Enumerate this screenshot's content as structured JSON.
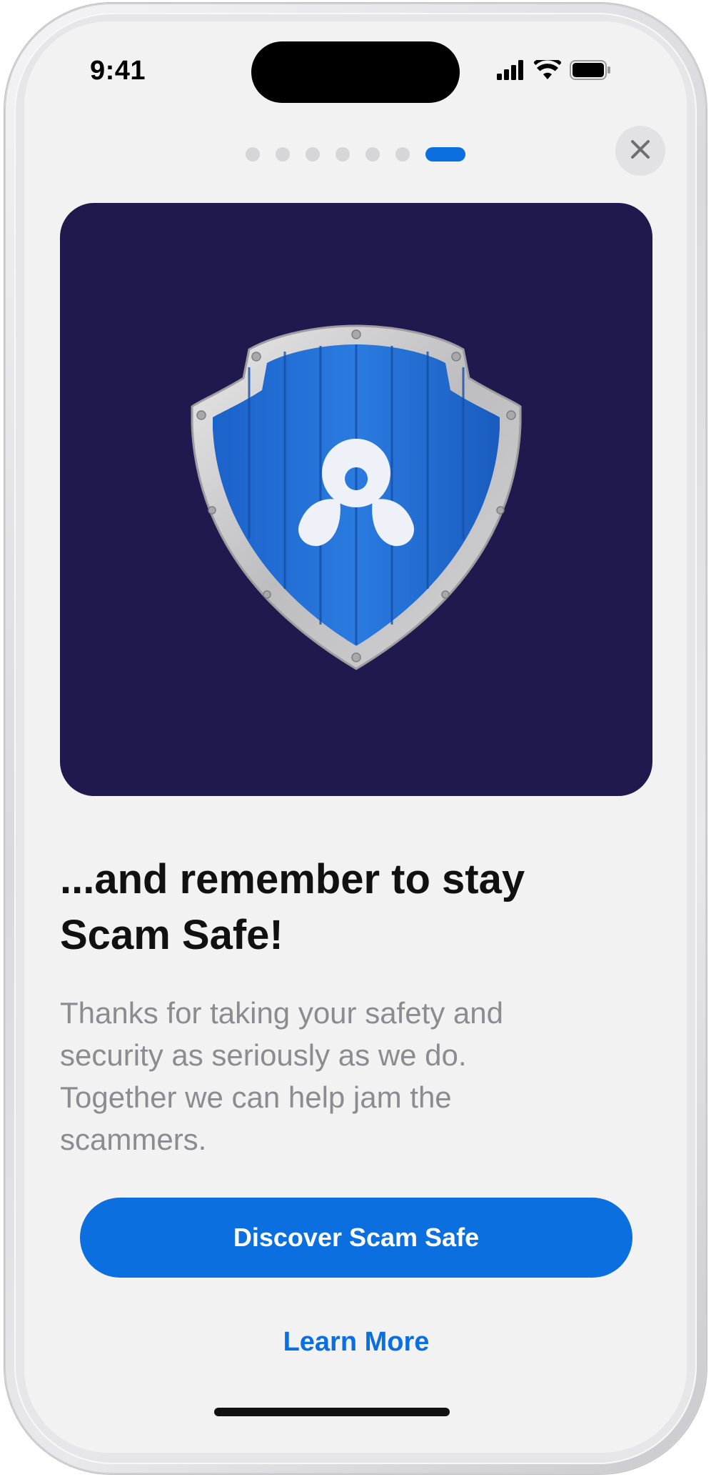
{
  "status_bar": {
    "time": "9:41",
    "icons": [
      "cellular-signal-icon",
      "wifi-icon",
      "battery-icon"
    ]
  },
  "pager": {
    "total": 7,
    "active_index": 6
  },
  "close_icon": "close-icon",
  "hero": {
    "illustration": "shield-logo-icon",
    "background_color": "#1f194e"
  },
  "content": {
    "headline_line1": "...and remember to stay",
    "headline_line2": "Scam Safe!",
    "body_line1": "Thanks for taking your safety and",
    "body_line2": "security as seriously as we do.",
    "body_line3": "Together we can help jam the",
    "body_line4": "scammers."
  },
  "actions": {
    "primary_label": "Discover Scam Safe",
    "secondary_label": "Learn More"
  },
  "colors": {
    "accent": "#0b6fe0",
    "screen_background": "#f2f2f3",
    "body_text": "#8b8b90"
  }
}
